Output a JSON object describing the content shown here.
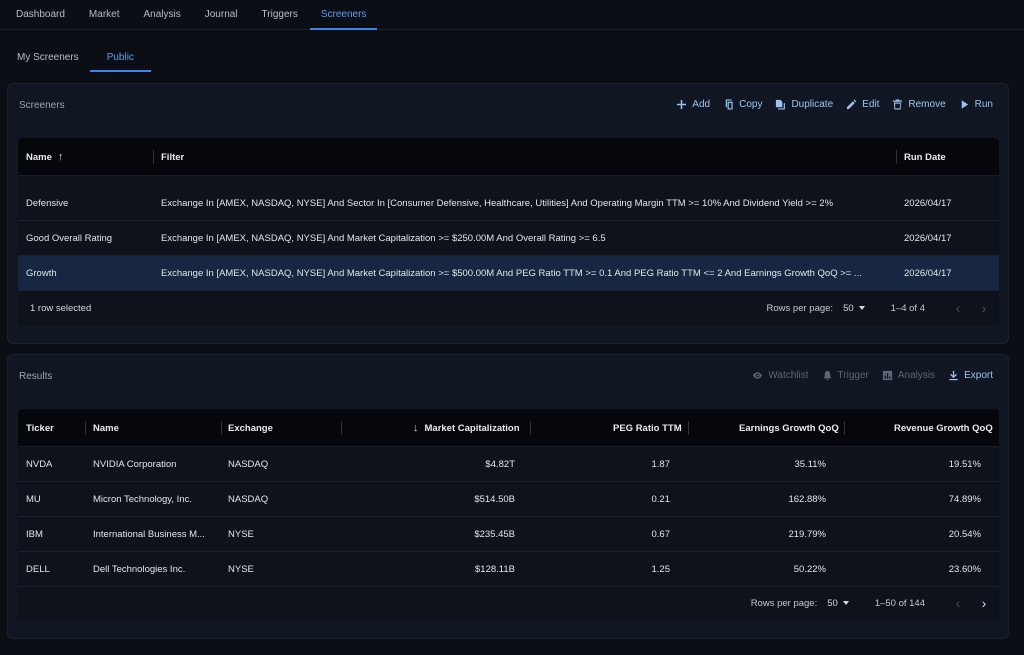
{
  "nav": {
    "tabs": [
      "Dashboard",
      "Market",
      "Analysis",
      "Journal",
      "Triggers",
      "Screeners"
    ],
    "active": 5
  },
  "subnav": {
    "tabs": [
      "My Screeners",
      "Public"
    ],
    "active": 1
  },
  "screeners": {
    "title": "Screeners",
    "toolbar": {
      "add": "Add",
      "copy": "Copy",
      "duplicate": "Duplicate",
      "edit": "Edit",
      "remove": "Remove",
      "run": "Run"
    },
    "columns": {
      "name": "Name",
      "filter": "Filter",
      "run_date": "Run Date"
    },
    "rows": [
      {
        "name": "Defensive",
        "filter": "Exchange In [AMEX, NASDAQ, NYSE] And Sector In [Consumer Defensive, Healthcare, Utilities] And Operating Margin TTM >= 10% And Dividend Yield >= 2%",
        "run_date": "2026/04/17"
      },
      {
        "name": "Good Overall Rating",
        "filter": "Exchange In [AMEX, NASDAQ, NYSE] And Market Capitalization >= $250.00M And Overall Rating >= 6.5",
        "run_date": "2026/04/17"
      },
      {
        "name": "Growth",
        "filter": "Exchange In [AMEX, NASDAQ, NYSE] And Market Capitalization >= $500.00M And PEG Ratio TTM >= 0.1 And PEG Ratio TTM <= 2 And Earnings Growth QoQ >= ...",
        "run_date": "2026/04/17"
      }
    ],
    "selected_text": "1 row selected",
    "rows_per_page_label": "Rows per page:",
    "rows_per_page": "50",
    "range": "1–4 of 4"
  },
  "results": {
    "title": "Results",
    "toolbar": {
      "watchlist": "Watchlist",
      "trigger": "Trigger",
      "analysis": "Analysis",
      "export": "Export"
    },
    "columns": {
      "ticker": "Ticker",
      "name": "Name",
      "exchange": "Exchange",
      "market_cap": "Market Capitalization",
      "peg": "PEG Ratio TTM",
      "earnings": "Earnings Growth QoQ",
      "revenue": "Revenue Growth QoQ"
    },
    "rows": [
      {
        "ticker": "NVDA",
        "name": "NVIDIA Corporation",
        "exchange": "NASDAQ",
        "market_cap": "$4.82T",
        "peg": "1.87",
        "earnings": "35.11%",
        "revenue": "19.51%"
      },
      {
        "ticker": "MU",
        "name": "Micron Technology, Inc.",
        "exchange": "NASDAQ",
        "market_cap": "$514.50B",
        "peg": "0.21",
        "earnings": "162.88%",
        "revenue": "74.89%"
      },
      {
        "ticker": "IBM",
        "name": "International Business M...",
        "exchange": "NYSE",
        "market_cap": "$235.45B",
        "peg": "0.67",
        "earnings": "219.79%",
        "revenue": "20.54%"
      },
      {
        "ticker": "DELL",
        "name": "Dell Technologies Inc.",
        "exchange": "NYSE",
        "market_cap": "$128.11B",
        "peg": "1.25",
        "earnings": "50.22%",
        "revenue": "23.60%"
      }
    ],
    "rows_per_page_label": "Rows per page:",
    "rows_per_page": "50",
    "range": "1–50 of 144"
  },
  "colors": {
    "background": "#0b0e14",
    "panel": "#111722",
    "accent": "#3d85e8",
    "selected_row": "#172741"
  }
}
